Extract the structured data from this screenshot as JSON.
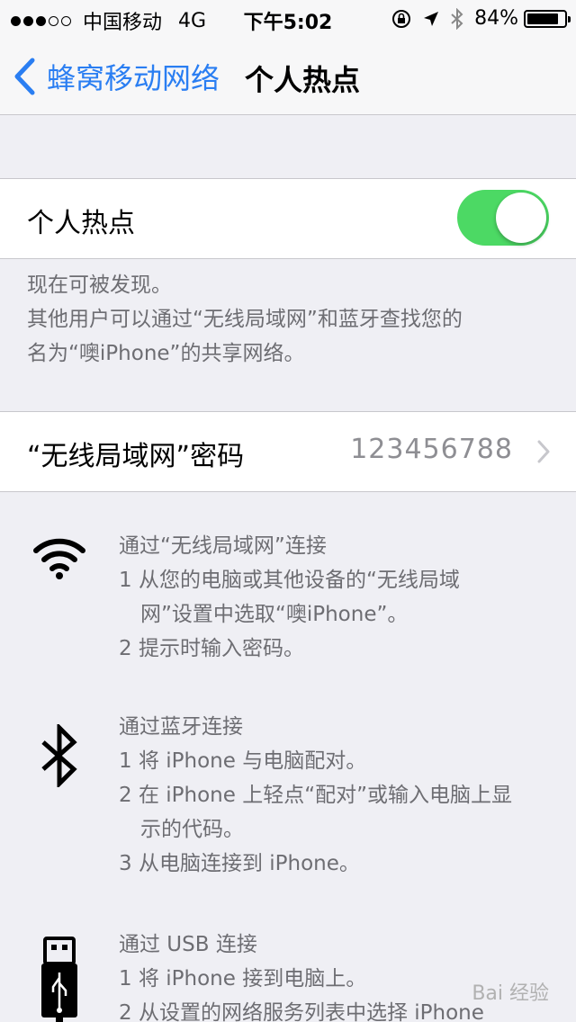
{
  "status_bar": {
    "signal_dots": [
      "on",
      "on",
      "on",
      "off",
      "off"
    ],
    "carrier": "中国移动",
    "network": "4G",
    "time": "下午5:02",
    "battery_percent": "84%",
    "battery_level": 0.84
  },
  "nav": {
    "back_label": "蜂窝移动网络",
    "title": "个人热点"
  },
  "hotspot": {
    "label": "个人热点",
    "enabled": true,
    "toggle_color": "#4cd964"
  },
  "discoverable": {
    "line1": "现在可被发现。",
    "line2": "其他用户可以通过“无线局域网”和蓝牙查找您的",
    "line3": "名为“噢iPhone”的共享网络。"
  },
  "password": {
    "label": "“无线局域网”密码",
    "value": "123456788"
  },
  "wifi_section": {
    "icon": "wifi-icon",
    "title": "通过“无线局域网”连接",
    "step1_a": "1 从您的电脑或其他设备的“无线局域",
    "step1_b": "网”设置中选取“噢iPhone”。",
    "step2": "2 提示时输入密码。"
  },
  "bt_section": {
    "icon": "bluetooth-icon",
    "title": "通过蓝牙连接",
    "step1": "1 将 iPhone 与电脑配对。",
    "step2_a": "2 在 iPhone 上轻点“配对”或输入电脑上显",
    "step2_b": "示的代码。",
    "step3": "3 从电脑连接到 iPhone。"
  },
  "usb_section": {
    "icon": "usb-icon",
    "title": "通过 USB 连接",
    "step1": "1 将 iPhone 接到电脑上。",
    "step2": "2 从设置的网络服务列表中选择 iPhone"
  },
  "watermark": "Bai 经验",
  "colors": {
    "accent": "#2a7ef2",
    "background": "#efeff4",
    "footnote": "#6d6d72"
  }
}
